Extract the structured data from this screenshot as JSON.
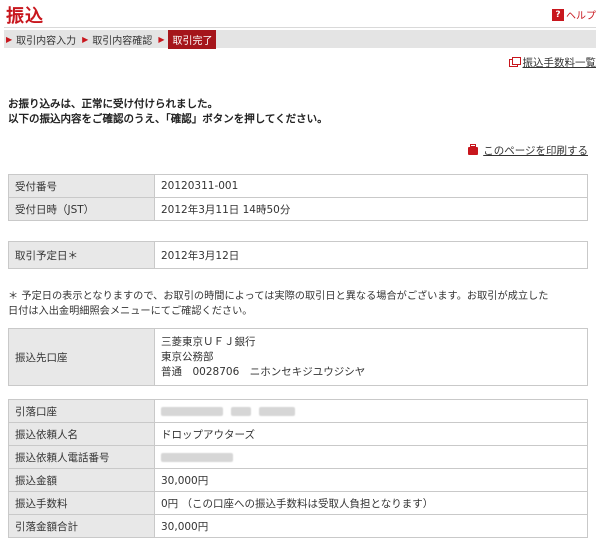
{
  "header": {
    "title": "振込",
    "help_label": "ヘルプ",
    "help_icon": "question-icon"
  },
  "steps": [
    {
      "label": "取引内容入力",
      "state": "done"
    },
    {
      "label": "取引内容確認",
      "state": "done"
    },
    {
      "label": "取引完了",
      "state": "current"
    }
  ],
  "links": {
    "fee_list": "振込手数料一覧",
    "print_page": "このページを印刷する"
  },
  "notice": {
    "line1": "お振り込みは、正常に受け付けられました。",
    "line2": "以下の振込内容をご確認のうえ、「確認」ボタンを押してください。"
  },
  "receipt": {
    "number_label": "受付番号",
    "number_value": "20120311-001",
    "datetime_label": "受付日時（JST）",
    "datetime_value": "2012年3月11日 14時50分"
  },
  "schedule": {
    "label": "取引予定日＊",
    "value": "2012年3月12日"
  },
  "note": {
    "line1": "＊ 予定日の表示となりますので、お取引の時間によっては実際の取引日と異なる場合がございます。お取引が成立した",
    "line2": "日付は入出金明細照会メニューにてご確認ください。"
  },
  "destination": {
    "label": "振込先口座",
    "bank": "三菱東京ＵＦＪ銀行",
    "branch": "東京公務部",
    "account": "普通　0028706　ニホンセキジユウジシヤ"
  },
  "details": {
    "debit_account_label": "引落口座",
    "requester_name_label": "振込依頼人名",
    "requester_name_value": "ドロップアウターズ",
    "requester_phone_label": "振込依頼人電話番号",
    "amount_label": "振込金額",
    "amount_value": "30,000円",
    "fee_label": "振込手数料",
    "fee_value": "0円 （この口座への振込手数料は受取人負担となります）",
    "total_label": "引落金額合計",
    "total_value": "30,000円"
  },
  "colors": {
    "accent": "#c8161d",
    "step_current": "#a5151b",
    "label_bg": "#e8e8e8"
  }
}
